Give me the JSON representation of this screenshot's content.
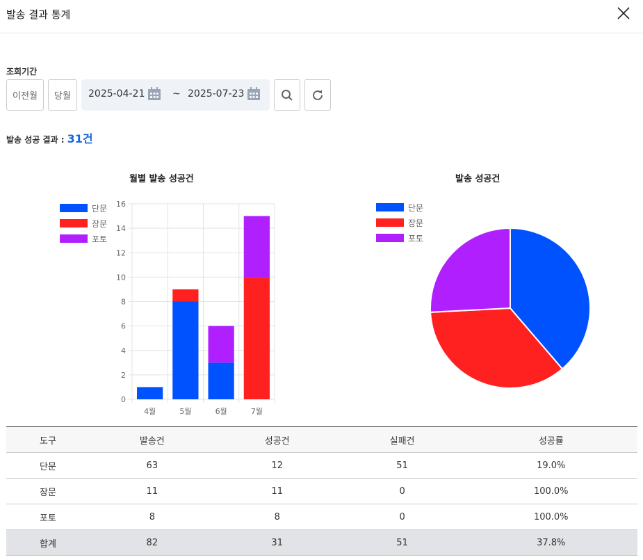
{
  "title": "발송 결과 통계",
  "period_label": "조회기간",
  "buttons": {
    "prev_month": "이전월",
    "this_month": "당월"
  },
  "date_from": "2025-04-21",
  "tilde": "~",
  "date_to": "2025-07-23",
  "result_label": "발송 성공 결과 :",
  "result_value": "31건",
  "colors": {
    "sms": "#0052ff",
    "lms": "#ff2020",
    "mms": "#b020ff",
    "accent": "#1565e0"
  },
  "chart_data": [
    {
      "type": "bar",
      "stacked": true,
      "title": "월별 발송 성공건",
      "categories": [
        "4월",
        "5월",
        "6월",
        "7월"
      ],
      "series": [
        {
          "name": "단문",
          "values": [
            1,
            8,
            3,
            0
          ]
        },
        {
          "name": "장문",
          "values": [
            0,
            1,
            0,
            10
          ]
        },
        {
          "name": "포토",
          "values": [
            0,
            0,
            3,
            5
          ]
        }
      ],
      "ylim": [
        0,
        16
      ],
      "yticks": [
        0,
        2,
        4,
        6,
        8,
        10,
        12,
        14,
        16
      ],
      "legend": "left"
    },
    {
      "type": "pie",
      "title": "발송 성공건",
      "labels": [
        "단문",
        "장문",
        "포토"
      ],
      "values": [
        12,
        11,
        8
      ],
      "legend": "top-left"
    }
  ],
  "table": {
    "headers": [
      "도구",
      "발송건",
      "성공건",
      "실패건",
      "성공률"
    ],
    "rows": [
      [
        "단문",
        "63",
        "12",
        "51",
        "19.0%"
      ],
      [
        "장문",
        "11",
        "11",
        "0",
        "100.0%"
      ],
      [
        "포토",
        "8",
        "8",
        "0",
        "100.0%"
      ]
    ],
    "total": [
      "합계",
      "82",
      "31",
      "51",
      "37.8%"
    ]
  }
}
